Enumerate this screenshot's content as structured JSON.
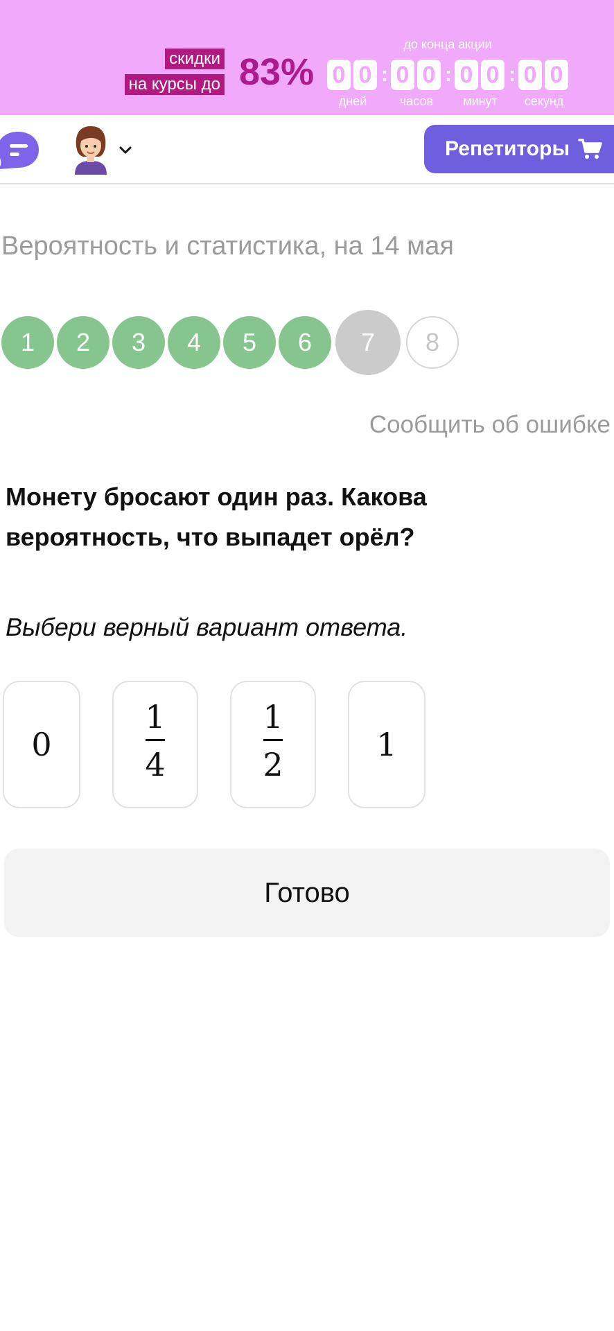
{
  "promo": {
    "tag_line1": "скидки",
    "tag_line2": "на курсы до",
    "percent": "83%",
    "timer_caption": "до конца акции",
    "digits": [
      "0",
      "0",
      "0",
      "0",
      "0",
      "0",
      "0",
      "0"
    ],
    "units": [
      "дней",
      "часов",
      "минут",
      "секунд"
    ],
    "colors": {
      "background": "#f1a9fb",
      "tag": "#b0197f",
      "percent": "#ac1a8e"
    }
  },
  "header": {
    "chat_icon": "chat-bubble-icon",
    "avatar_icon": "avatar-icon",
    "menu_icon": "chevron-down-icon",
    "tutors_label": "Репетиторы",
    "tutors_icon": "cart-icon",
    "colors": {
      "tutors_button": "#6f5ede",
      "chat": "#7d64e8"
    }
  },
  "lesson": {
    "title": "Вероятность и статистика, на 14 мая",
    "steps": [
      {
        "label": "1",
        "state": "done"
      },
      {
        "label": "2",
        "state": "done"
      },
      {
        "label": "3",
        "state": "done"
      },
      {
        "label": "4",
        "state": "done"
      },
      {
        "label": "5",
        "state": "done"
      },
      {
        "label": "6",
        "state": "done"
      },
      {
        "label": "7",
        "state": "current"
      },
      {
        "label": "8",
        "state": "todo"
      }
    ],
    "report_error": "Сообщить об ошибке",
    "question": "Монету бросают один раз. Какова вероятность, что выпадет орёл?",
    "instruction": "Выбери верный вариант ответа.",
    "options": [
      {
        "value": "0"
      },
      {
        "numerator": "1",
        "denominator": "4"
      },
      {
        "numerator": "1",
        "denominator": "2"
      },
      {
        "value": "1"
      }
    ],
    "submit_label": "Готово",
    "colors": {
      "done_step": "#86c58e",
      "current_step": "#cbcbcb"
    }
  }
}
